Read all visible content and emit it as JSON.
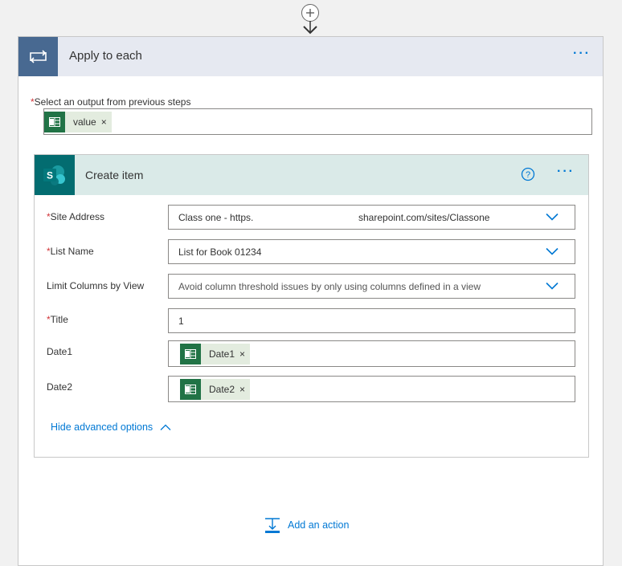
{
  "apply_to_each": {
    "title": "Apply to each",
    "more_label": "···",
    "select_label": "Select an output from previous steps",
    "required_mark": "*",
    "token": {
      "label": "value",
      "remove": "×"
    }
  },
  "create_item": {
    "title": "Create item",
    "more_label": "···",
    "help_icon": "question-circle-icon",
    "fields": {
      "site_address": {
        "label": "Site Address",
        "required": "*",
        "value": "Class one - https.",
        "value_tail": "sharepoint.com/sites/Classone"
      },
      "list_name": {
        "label": "List Name",
        "required": "*",
        "value": "List for Book 01234"
      },
      "limit_columns": {
        "label": "Limit Columns by View",
        "value": "Avoid column threshold issues by only using columns defined in a view"
      },
      "title": {
        "label": "Title",
        "required": "*",
        "value": "1"
      },
      "date1": {
        "label": "Date1",
        "token": "Date1",
        "remove": "×"
      },
      "date2": {
        "label": "Date2",
        "token": "Date2",
        "remove": "×"
      }
    },
    "hide_advanced": "Hide advanced options"
  },
  "add_action": {
    "label": "Add an action"
  },
  "colors": {
    "accent": "#0078d4",
    "apply_header": "#486991",
    "sharepoint": "#036c70",
    "excel": "#217346",
    "required": "#d13438"
  }
}
